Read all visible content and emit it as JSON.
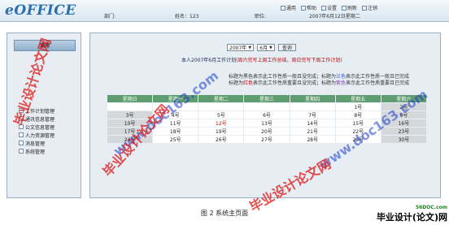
{
  "header": {
    "logo": "eOFFICE",
    "dept_label": "部门:",
    "name_label": "姓名：123",
    "position_label": "职位:",
    "date": "2007年6月12日星期二"
  },
  "toolbar": [
    {
      "label": "通用",
      "icon": "home-icon"
    },
    {
      "label": "帮助",
      "icon": "help-icon"
    },
    {
      "label": "设置",
      "icon": "settings-icon"
    },
    {
      "label": "刷新",
      "icon": "refresh-icon"
    },
    {
      "label": "注销",
      "icon": "logout-icon"
    }
  ],
  "sidebar": {
    "title": "通用",
    "items": [
      {
        "label": "工作计划管理"
      },
      {
        "label": "通讯信息管理"
      },
      {
        "label": "公文信息管理"
      },
      {
        "label": "人力资源管理"
      },
      {
        "label": "消息管理"
      },
      {
        "label": "系统管理"
      }
    ]
  },
  "controls": {
    "year": "2007年",
    "month": "6月",
    "query_label": "查询"
  },
  "plan_title": {
    "main": "本人2007年6月工作计划",
    "note": "(周六完写上周工作总结，周日完写下周工作计划)"
  },
  "legend": {
    "line1_a": "标题为黑色表示此工作性质一般且没完成；标题为",
    "line1_b": "兰色",
    "line1_c": "表示此工作性质一般且已完成",
    "line2_a": "标题为",
    "line2_b": "红色",
    "line2_c": "表示此工作性质重要且没完成；标题为",
    "line2_d": "紫色",
    "line2_e": "表示此工作性质重要且已完成"
  },
  "calendar": {
    "headers": [
      "星期日",
      "星期一",
      "星期二",
      "星期三",
      "星期四",
      "星期五",
      "星期六"
    ],
    "rows": [
      [
        "",
        "",
        "",
        "",
        "",
        "1号",
        "2号"
      ],
      [
        "3号",
        "4号",
        "5号",
        "6号",
        "7号",
        "8号",
        "9号"
      ],
      [
        "10号",
        "11号",
        "12号",
        "13号",
        "14号",
        "15号",
        "16号"
      ],
      [
        "17号",
        "18号",
        "19号",
        "20号",
        "21号",
        "22号",
        "23号"
      ],
      [
        "24号",
        "25号",
        "26号",
        "27号",
        "28号",
        "29号",
        "30号"
      ]
    ],
    "today": "12号"
  },
  "caption": "图 2 系统主页面",
  "watermarks": {
    "red_text": "毕业设计论文网",
    "blue_text": "www.doc163.com",
    "badge_site": "56DOC.com",
    "badge_text": "毕业设计(论文)网"
  },
  "colors": {
    "calendar_header": "#5f9c6f",
    "weekend_cell": "#d5d8db",
    "logo": "#2b6fb1",
    "important": "#cc0000"
  }
}
